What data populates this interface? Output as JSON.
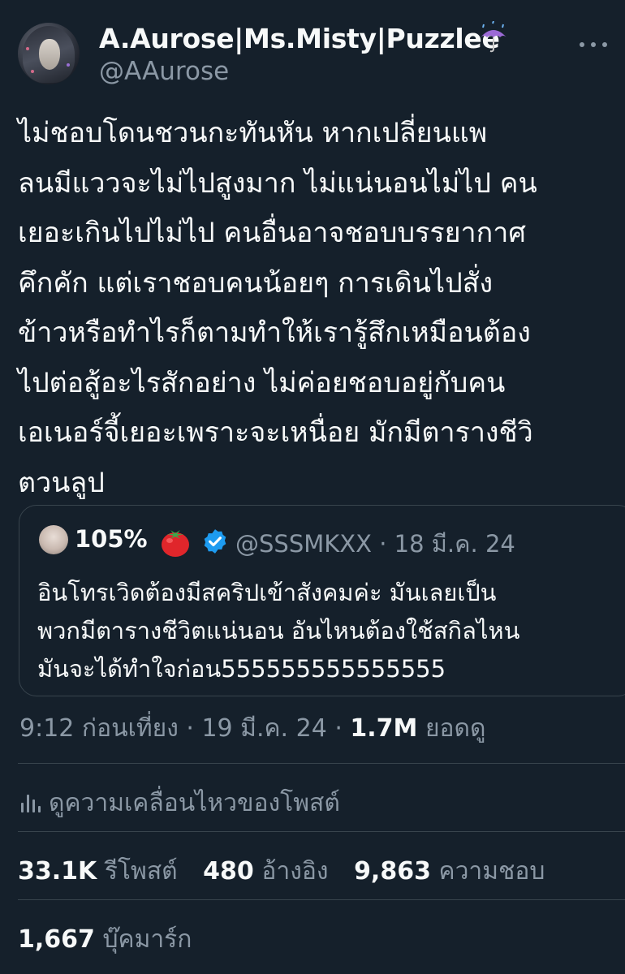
{
  "author": {
    "display_name": "A.Aurose|Ms.Misty|Puzzlee",
    "handle": "@AAurose",
    "name_emoji_icon": "umbrella-with-rain-icon"
  },
  "tweet": {
    "lines": [
      "ไม่ชอบโดนชวนกะทันหัน หากเปลี่ยนแพ",
      "ลนมีแววจะไม่ไปสูงมาก ไม่แน่นอนไม่ไป คน",
      "เยอะเกินไปไม่ไป คนอื่นอาจชอบบรรยากาศ",
      "คึกคัก แต่เราชอบคนน้อยๆ การเดินไปสั่ง",
      "ข้าวหรือทำไรก็ตามทำให้เรารู้สึกเหมือนต้อง",
      "ไปต่อสู้อะไรสักอย่าง ไม่ค่อยชอบอยู่กับคน",
      "เอเนอร์จี้เยอะเพราะจะเหนื่อย มักมีตารางชีวิ",
      "ตวนลูป"
    ]
  },
  "quote": {
    "name": "105%",
    "name_emoji_icon": "tomato-icon",
    "verified_icon": "verified-badge-icon",
    "meta": "@SSSMKXX · 18 มี.ค. 24",
    "lines": [
      "อินโทรเวิดต้องมีสคริปเข้าสังคมค่ะ มันเลยเป็น",
      "พวกมีตารางชีวิตแน่นอน อันไหนต้องใช้สกิลไหน",
      "มันจะได้ทำใจก่อน555555555555555"
    ]
  },
  "timestamp": {
    "time": "9:12 ก่อนเที่ยง · 19 มี.ค. 24 · ",
    "views_count": "1.7M",
    "views_label": " ยอดดู"
  },
  "analytics": {
    "label": "ดูความเคลื่อนไหวของโพสต์"
  },
  "stats": {
    "reposts_count": "33.1K",
    "reposts_label": "รีโพสต์",
    "quotes_count": "480",
    "quotes_label": "อ้างอิง",
    "likes_count": "9,863",
    "likes_label": "ความชอบ",
    "bookmarks_count": "1,667",
    "bookmarks_label": "บุ๊คมาร์ก"
  },
  "colors": {
    "background": "#15202b",
    "text_primary": "#f7f9f9",
    "text_secondary": "#8b98a5",
    "border": "#38444d",
    "verified": "#1d9bf0"
  }
}
